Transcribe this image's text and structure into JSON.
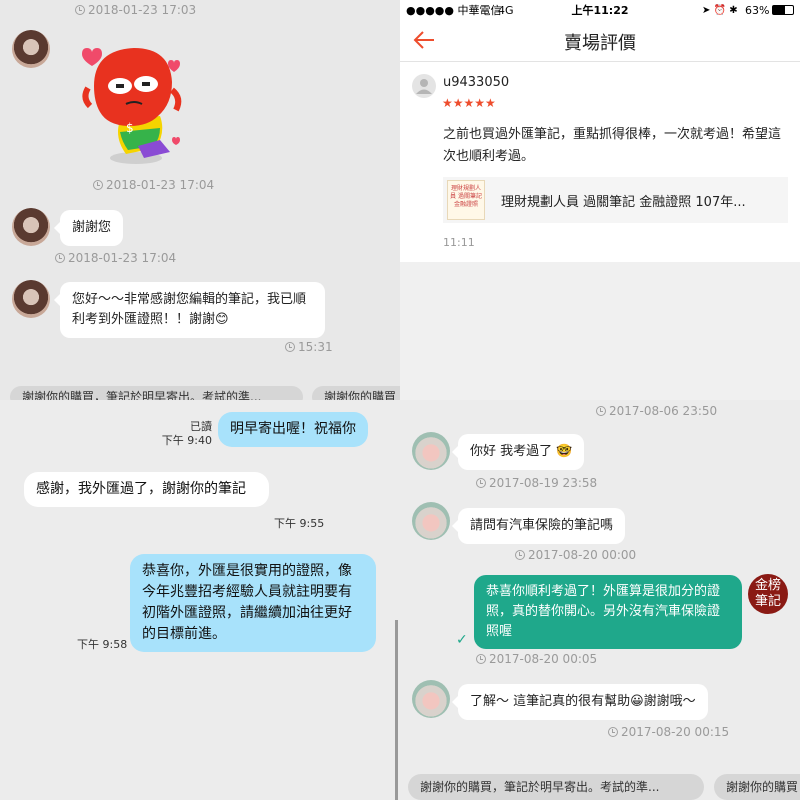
{
  "top_left": {
    "timestamps": [
      "2018-01-23 17:03",
      "2018-01-23 17:04",
      "2018-01-23 17:04",
      "15:31"
    ],
    "messages": [
      {
        "text": "謝謝您"
      },
      {
        "text": "您好～～非常感謝您編輯的筆記，我已順利考到外匯證照！！謝謝😊"
      }
    ],
    "quick_replies": [
      "謝謝你的購買，筆記於明早寄出。考試的準...",
      "謝謝你的購買"
    ]
  },
  "top_right": {
    "status_bar": {
      "carrier": "●●●●● 中華電信",
      "network": "4G",
      "time": "上午11:22",
      "battery": "63%"
    },
    "title": "賣場評價",
    "review": {
      "user": "u9433050",
      "stars": "★★★★★",
      "text": "之前也買過外匯筆記，重點抓得很棒，一次就考過！希望這次也順利考過。",
      "product_name": "理財規劃人員 過關筆記 金融證照 107年...",
      "product_thumb_text": "理財規劃人員 過關筆記 金融證照",
      "time": "11:11"
    },
    "colors": {
      "accent": "#ee4d2d"
    }
  },
  "bottom_left": {
    "messages": [
      {
        "from": "me",
        "text": "明早寄出喔！祝福你",
        "read": "已讀",
        "time": "下午 9:40"
      },
      {
        "from": "other",
        "text": "感謝，我外匯過了，謝謝你的筆記",
        "time": "下午 9:55"
      },
      {
        "from": "me",
        "text": "恭喜你，外匯是很實用的證照，像今年兆豐招考經驗人員就註明要有初階外匯證照，請繼續加油往更好的目標前進。",
        "time": "下午 9:58"
      }
    ]
  },
  "bottom_right": {
    "timestamps": [
      "2017-08-06 23:50",
      "2017-08-19 23:58",
      "2017-08-20 00:00",
      "2017-08-20 00:05",
      "2017-08-20 00:15"
    ],
    "messages": [
      {
        "from": "other",
        "text": "你好 我考過了 🤓"
      },
      {
        "from": "other",
        "text": "請問有汽車保險的筆記嗎"
      },
      {
        "from": "me",
        "text": "恭喜你順利考過了！外匯算是很加分的證照，真的替你開心。另外沒有汽車保險證照喔"
      },
      {
        "from": "other",
        "text": "了解～ 這筆記真的很有幫助😀謝謝哦～"
      }
    ],
    "seal_text": "金榜筆記",
    "quick_replies": [
      "謝謝你的購買，筆記於明早寄出。考試的準...",
      "謝謝你的購買"
    ]
  }
}
